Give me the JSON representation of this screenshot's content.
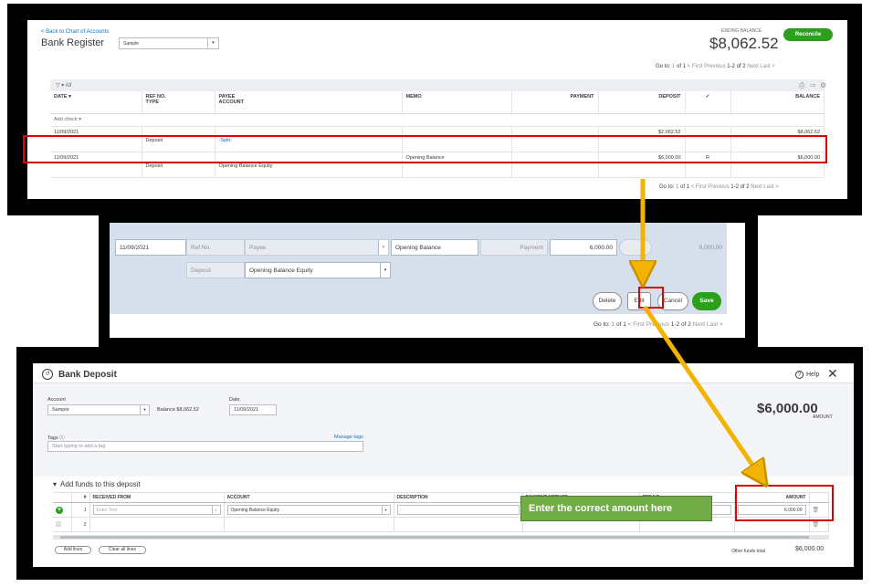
{
  "register": {
    "back_link": "< Back to Chart of Accounts",
    "title": "Bank Register",
    "account": "Sample",
    "ending_balance_label": "ENDING BALANCE",
    "ending_balance": "$8,062.52",
    "reconcile": "Reconcile",
    "pager_top": {
      "goto": "Go to:",
      "page": "1",
      "of": "of 1",
      "first": "< First",
      "prev": "Previous",
      "range": "1-2 of 2",
      "next": "Next",
      "last": "Last >"
    },
    "pager_bottom": {
      "goto": "Go to:",
      "page": "1",
      "of": "of 1",
      "first": "< First",
      "prev": "Previous",
      "range": "1-2 of 2",
      "next": "Next",
      "last": "Last >"
    },
    "filter_label": "All",
    "headers": {
      "date": "DATE ▾",
      "ref": "REF NO.",
      "type": "TYPE",
      "payee": "PAYEE",
      "account": "ACCOUNT",
      "memo": "MEMO",
      "payment": "PAYMENT",
      "deposit": "DEPOSIT",
      "check": "✓",
      "balance": "BALANCE"
    },
    "add_check": "Add check ▾",
    "rows": [
      {
        "date": "11/09/2021",
        "type": "Deposit",
        "account": "-Split-",
        "memo": "",
        "payment": "",
        "deposit": "$2,062.52",
        "status": "",
        "balance": "$8,062.52"
      },
      {
        "date": "11/09/2021",
        "type": "Deposit",
        "account": "Opening Balance Equity",
        "memo": "Opening Balance",
        "payment": "",
        "deposit": "$6,000.00",
        "status": "R",
        "balance": "$6,000.00"
      }
    ]
  },
  "edit_row": {
    "date": "11/09/2021",
    "ref_placeholder": "Ref No.",
    "payee_placeholder": "Payee",
    "memo": "Opening Balance",
    "payment_placeholder": "Payment",
    "deposit": "6,000.00",
    "balance": "6,000.00",
    "type": "Deposit",
    "account": "Opening Balance Equity",
    "buttons": {
      "delete": "Delete",
      "edit": "Edit",
      "cancel": "Cancel",
      "save": "Save"
    },
    "pager": {
      "goto": "Go to:",
      "page": "1",
      "of": "of 1",
      "first": "< First",
      "prev": "Previous",
      "range": "1-2 of 2",
      "next": "Next",
      "last": "Last >"
    }
  },
  "deposit": {
    "title": "Bank Deposit",
    "help": "Help",
    "account_label": "Account",
    "account": "Sample",
    "balance": "Balance $8,062.52",
    "date_label": "Date",
    "date": "11/09/2021",
    "amount_label": "AMOUNT",
    "amount": "$6,000.00",
    "tags_label": "Tags",
    "manage_tags": "Manage tags",
    "tags_placeholder": "Start typing to add a tag",
    "section_title": "Add funds to this deposit",
    "columns": {
      "num": "#",
      "received_from": "RECEIVED FROM",
      "account": "ACCOUNT",
      "description": "DESCRIPTION",
      "payment_method": "PAYMENT METHOD",
      "ref_no": "REF NO.",
      "amount": "AMOUNT"
    },
    "lines": [
      {
        "num": "1",
        "received_from_placeholder": "Enter Text",
        "account": "Opening Balance Equity",
        "amount": "6,000.00"
      },
      {
        "num": "2"
      }
    ],
    "add_lines": "Add lines",
    "clear_lines": "Clear all lines",
    "other_funds_label": "Other funds total",
    "other_funds_total": "$6,000.00"
  },
  "annotation": {
    "callout": "Enter the correct amount here",
    "highlight_color": "#e00000",
    "arrow_color": "#f2b400",
    "callout_color": "#70ad47"
  }
}
